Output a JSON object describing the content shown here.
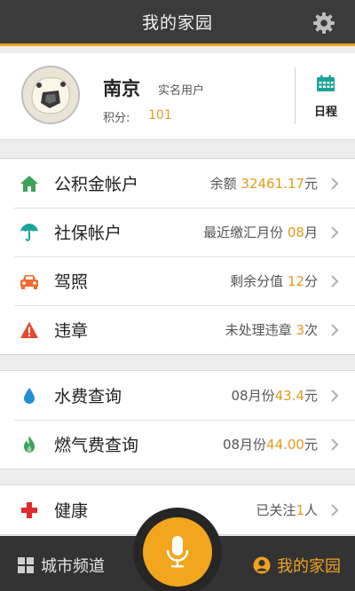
{
  "header": {
    "title": "我的家园",
    "settings_icon": "gear-icon"
  },
  "profile": {
    "name": "南京",
    "verified_label": "实名用户",
    "points_label": "积分:",
    "points_value": "101",
    "schedule_label": "日程",
    "schedule_icon": "calendar-icon"
  },
  "accounts": [
    {
      "icon": "house-icon",
      "label": "公积金帐户",
      "value_prefix": "余额 ",
      "value_highlight": "32461.17",
      "value_suffix": "元"
    },
    {
      "icon": "umbrella-icon",
      "label": "社保帐户",
      "value_prefix": "最近缴汇月份 ",
      "value_highlight": "08",
      "value_suffix": "月"
    },
    {
      "icon": "car-icon",
      "label": "驾照",
      "value_prefix": "剩余分值 ",
      "value_highlight": "12",
      "value_suffix": "分"
    },
    {
      "icon": "warning-icon",
      "label": "违章",
      "value_prefix": "未处理违章 ",
      "value_highlight": "3",
      "value_suffix": "次"
    }
  ],
  "utilities": [
    {
      "icon": "water-drop-icon",
      "label": "水费查询",
      "value_prefix": "08月份",
      "value_highlight": "43.4",
      "value_suffix": "元"
    },
    {
      "icon": "flame-icon",
      "label": "燃气费查询",
      "value_prefix": "08月份",
      "value_highlight": "44.00",
      "value_suffix": "元"
    }
  ],
  "health": [
    {
      "icon": "red-cross-icon",
      "label": "健康",
      "value_prefix": "已关注",
      "value_highlight": "1",
      "value_suffix": "人"
    }
  ],
  "bottom_nav": {
    "left_label": "城市频道",
    "right_label": "我的家园",
    "mic_icon": "microphone-icon"
  },
  "colors": {
    "accent": "#f0a11f",
    "highlight_text": "#e39a1b",
    "header_bg": "#3b3b3b",
    "teal_icon": "#1aa39a"
  }
}
